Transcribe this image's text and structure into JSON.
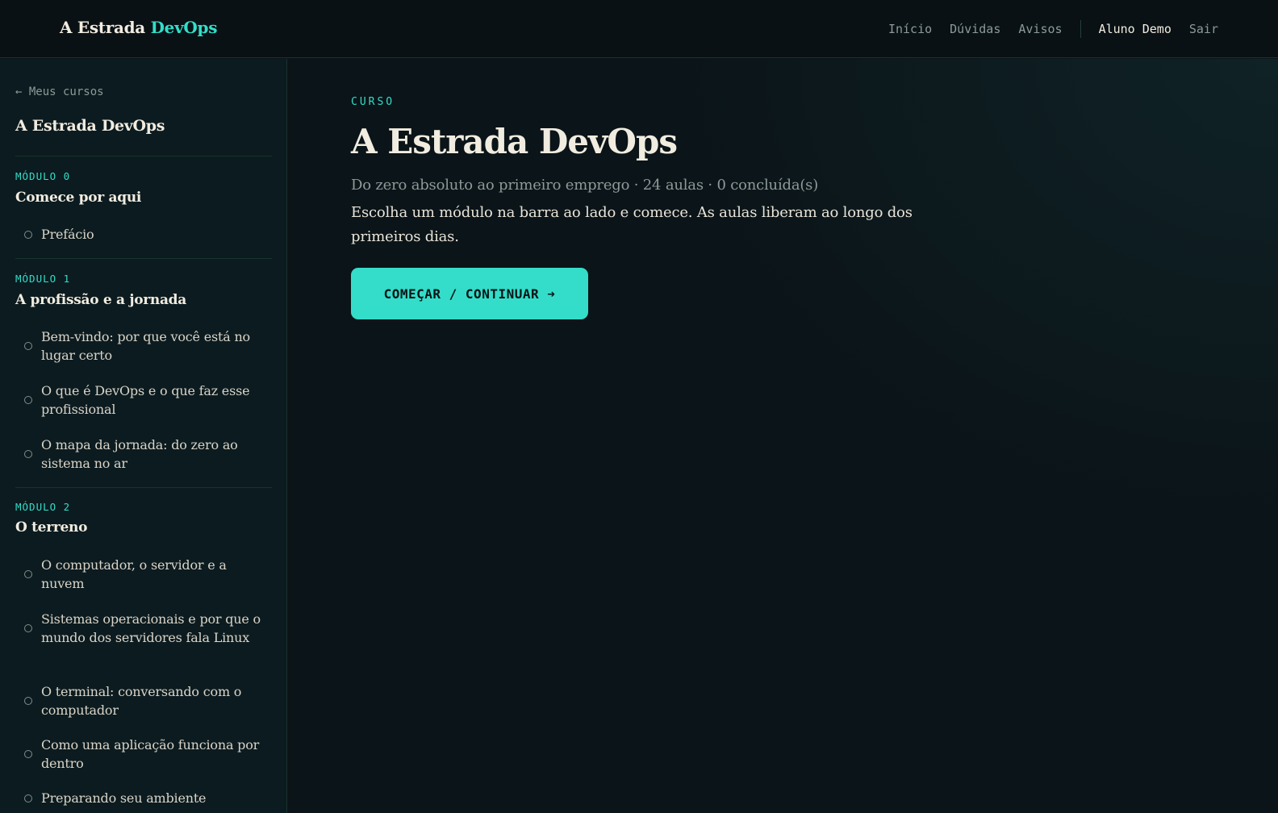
{
  "header": {
    "brand_prefix": "A Estrada",
    "brand_accent": "DevOps",
    "nav": [
      "Início",
      "Dúvidas",
      "Avisos"
    ],
    "user": "Aluno Demo",
    "logout": "Sair"
  },
  "sidebar": {
    "back": "← Meus cursos",
    "course_title": "A Estrada DevOps",
    "modules": [
      {
        "label": "MÓDULO 0",
        "title": "Comece por aqui",
        "lessons": [
          "Prefácio"
        ]
      },
      {
        "label": "MÓDULO 1",
        "title": "A profissão e a jornada",
        "lessons": [
          "Bem-vindo: por que você está no lugar certo",
          "O que é DevOps e o que faz esse profissional",
          "O mapa da jornada: do zero ao sistema no ar"
        ]
      },
      {
        "label": "MÓDULO 2",
        "title": "O terreno",
        "lessons": [
          "O computador, o servidor e a nuvem",
          "Sistemas operacionais e por que o mundo dos servidores fala Linux",
          "O terminal: conversando com o computador",
          "Como uma aplicação funciona por dentro",
          "Preparando seu ambiente"
        ]
      }
    ]
  },
  "main": {
    "eyebrow": "CURSO",
    "title": "A Estrada DevOps",
    "meta": "Do zero absoluto ao primeiro emprego · 24 aulas · 0 concluída(s)",
    "description": "Escolha um módulo na barra ao lado e comece. As aulas liberam ao longo dos primeiros dias.",
    "cta": "COMEÇAR / CONTINUAR ➜"
  },
  "colors": {
    "accent": "#33ddc9",
    "background": "#0b1418",
    "sidebar": "#0c1b1f",
    "text": "#f1ece0",
    "muted": "#8c9a98"
  }
}
